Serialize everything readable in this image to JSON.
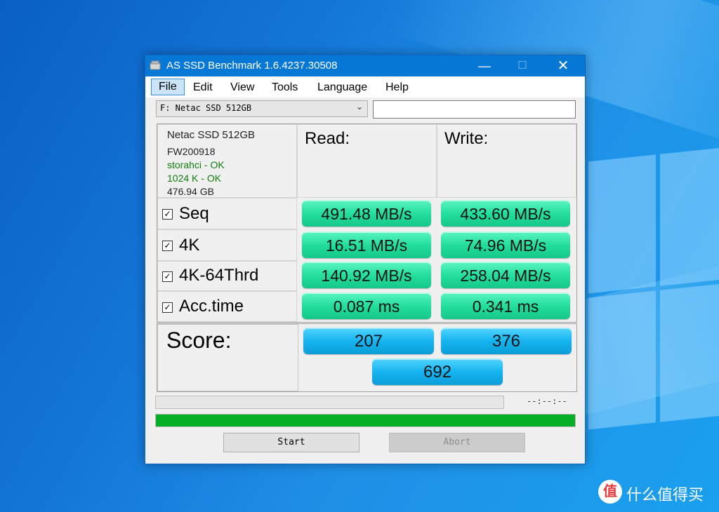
{
  "window": {
    "title": "AS SSD Benchmark 1.6.4237.30508",
    "controls": {
      "minimize": "—",
      "maximize": "☐",
      "close": "✕"
    }
  },
  "menu": [
    "File",
    "Edit",
    "View",
    "Tools",
    "Language",
    "Help"
  ],
  "drive": {
    "selected": "F: Netac SSD 512GB",
    "side_field_value": ""
  },
  "info": {
    "model": "Netac SSD 512GB",
    "firmware": "FW200918",
    "driver": "storahci - OK",
    "alignment": "1024 K - OK",
    "capacity": "476.94 GB"
  },
  "headers": {
    "read": "Read:",
    "write": "Write:"
  },
  "rows": [
    {
      "label": "Seq",
      "checked": true,
      "read": "491.48 MB/s",
      "write": "433.60 MB/s"
    },
    {
      "label": "4K",
      "checked": true,
      "read": "16.51 MB/s",
      "write": "74.96 MB/s"
    },
    {
      "label": "4K-64Thrd",
      "checked": true,
      "read": "140.92 MB/s",
      "write": "258.04 MB/s"
    },
    {
      "label": "Acc.time",
      "checked": true,
      "read": "0.087 ms",
      "write": "0.341 ms"
    }
  ],
  "score": {
    "label": "Score:",
    "read": "207",
    "write": "376",
    "total": "692"
  },
  "progress": {
    "elapsed": "--:--:--",
    "main_fraction": 1.0
  },
  "buttons": {
    "start": "Start",
    "abort": "Abort"
  },
  "watermark": {
    "logo": "值",
    "text": "什么值得买"
  },
  "colors": {
    "titlebar": "#0878d7",
    "result_green": "#22de9c",
    "score_blue": "#14b3ef",
    "progress_green": "#06b025"
  }
}
